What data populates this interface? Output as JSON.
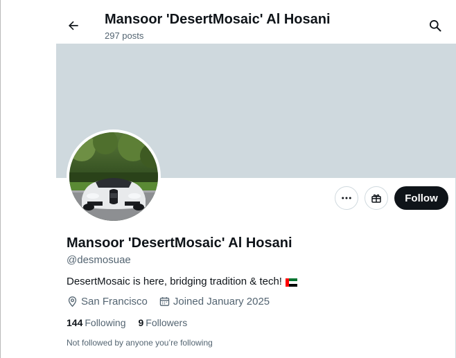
{
  "header": {
    "title": "Mansoor 'DesertMosaic' Al Hosani",
    "posts_count": "297 posts"
  },
  "profile": {
    "display_name": "Mansoor 'DesertMosaic' Al Hosani",
    "handle": "@desmosuae",
    "bio": "DesertMosaic is here, bridging tradition & tech!",
    "bio_emoji": "uae-flag-icon",
    "location": "San Francisco",
    "joined": "Joined January 2025",
    "following_count": "144",
    "following_label": "Following",
    "followers_count": "9",
    "followers_label": "Followers",
    "not_followed_note": "Not followed by anyone you’re following"
  },
  "actions": {
    "follow_label": "Follow",
    "more_icon": "more-icon",
    "gift_icon": "gift-icon"
  },
  "icons": {
    "back": "back-arrow-icon",
    "search": "search-icon",
    "location": "location-pin-icon",
    "calendar": "calendar-icon"
  },
  "colors": {
    "banner": "#cfd9de",
    "primary_text": "#0f1419",
    "secondary_text": "#536471",
    "follow_button_bg": "#0f1419",
    "follow_button_text": "#ffffff"
  }
}
